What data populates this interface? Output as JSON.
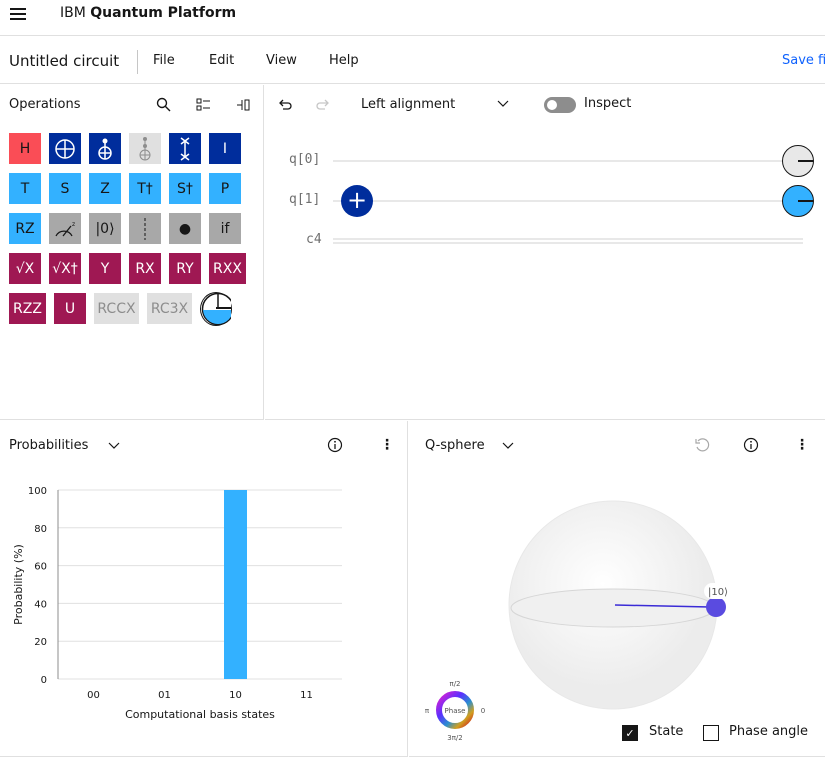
{
  "header": {
    "brand_prefix": "IBM",
    "brand_name": "Quantum Platform"
  },
  "toolbar": {
    "circuit_title": "Untitled circuit",
    "menu": [
      "File",
      "Edit",
      "View",
      "Help"
    ],
    "save_label": "Save fi"
  },
  "operations": {
    "title": "Operations",
    "gates": [
      [
        {
          "label": "H",
          "style": "h"
        },
        {
          "label": "⊕",
          "style": "db"
        },
        {
          "label": "CNOT",
          "style": "db"
        },
        {
          "label": "CCX",
          "style": "dis"
        },
        {
          "label": "SWAP",
          "style": "db"
        },
        {
          "label": "I",
          "style": "db"
        }
      ],
      [
        {
          "label": "T",
          "style": "lb"
        },
        {
          "label": "S",
          "style": "lb"
        },
        {
          "label": "Z",
          "style": "lb"
        },
        {
          "label": "T†",
          "style": "lb"
        },
        {
          "label": "S†",
          "style": "lb"
        },
        {
          "label": "P",
          "style": "lb"
        }
      ],
      [
        {
          "label": "RZ",
          "style": "lb"
        },
        {
          "label": "measure-z",
          "style": "gr"
        },
        {
          "label": "|0⟩",
          "style": "gr"
        },
        {
          "label": "barrier",
          "style": "gr"
        },
        {
          "label": "●",
          "style": "gr"
        },
        {
          "label": "if",
          "style": "gr"
        }
      ],
      [
        {
          "label": "√X",
          "style": "mg"
        },
        {
          "label": "√X†",
          "style": "mg"
        },
        {
          "label": "Y",
          "style": "mg"
        },
        {
          "label": "RX",
          "style": "mg"
        },
        {
          "label": "RY",
          "style": "mg"
        },
        {
          "label": "RXX",
          "style": "mg"
        }
      ],
      [
        {
          "label": "RZZ",
          "style": "mg"
        },
        {
          "label": "U",
          "style": "mg"
        },
        {
          "label": "RCCX",
          "style": "dis"
        },
        {
          "label": "RC3X",
          "style": "dis"
        },
        {
          "label": "measure-probability",
          "style": "meas"
        }
      ]
    ]
  },
  "circuit": {
    "alignment": "Left alignment",
    "inspect_label": "Inspect",
    "inspect_on": false,
    "wires": [
      "q[0]",
      "q[1]",
      "c4"
    ]
  },
  "probabilities": {
    "title": "Probabilities"
  },
  "qsphere": {
    "title": "Q-sphere",
    "state_label": "|10⟩",
    "phase_title": "Phase",
    "phase_labels": {
      "top": "π/2",
      "left": "π",
      "right": "0",
      "bottom": "3π/2"
    },
    "state_checkbox": {
      "label": "State",
      "checked": true
    },
    "phase_checkbox": {
      "label": "Phase angle",
      "checked": false
    }
  },
  "chart_data": {
    "type": "bar",
    "categories": [
      "00",
      "01",
      "10",
      "11"
    ],
    "values": [
      0,
      0,
      100,
      0
    ],
    "xlabel": "Computational basis states",
    "ylabel": "Probability (%)",
    "ylim": [
      0,
      100
    ],
    "yticks": [
      "0",
      "20",
      "40",
      "60",
      "80",
      "100"
    ],
    "color": "#33b1ff"
  }
}
